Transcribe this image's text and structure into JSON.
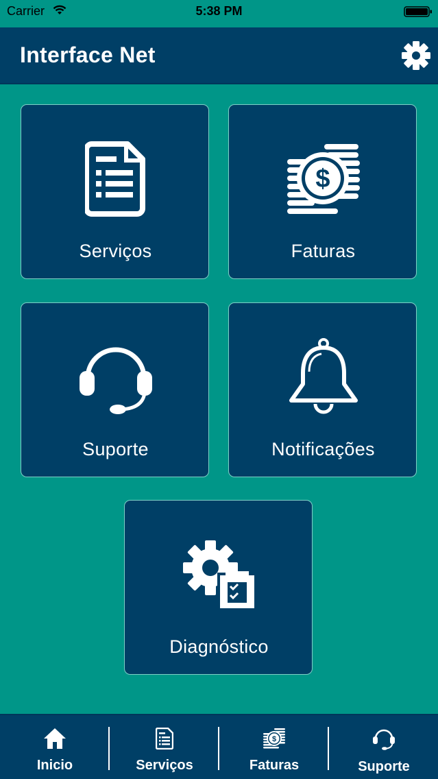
{
  "status_bar": {
    "carrier": "Carrier",
    "time": "5:38 PM"
  },
  "header": {
    "title": "Interface Net",
    "settings_icon": "gear-icon"
  },
  "tiles": [
    {
      "label": "Serviços",
      "icon": "document-list-icon"
    },
    {
      "label": "Faturas",
      "icon": "coins-dollar-icon"
    },
    {
      "label": "Suporte",
      "icon": "headset-icon"
    },
    {
      "label": "Notificações",
      "icon": "bell-icon"
    },
    {
      "label": "Diagnóstico",
      "icon": "gear-checklist-icon"
    }
  ],
  "tabbar": {
    "items": [
      {
        "label": "Inicio",
        "icon": "home-icon"
      },
      {
        "label": "Serviços",
        "icon": "document-list-icon"
      },
      {
        "label": "Faturas",
        "icon": "coins-dollar-icon"
      },
      {
        "label": "Suporte",
        "icon": "headset-icon"
      }
    ]
  },
  "colors": {
    "background": "#009688",
    "primary": "#003f66",
    "tile_border": "#7fcfc6",
    "text": "#ffffff"
  }
}
